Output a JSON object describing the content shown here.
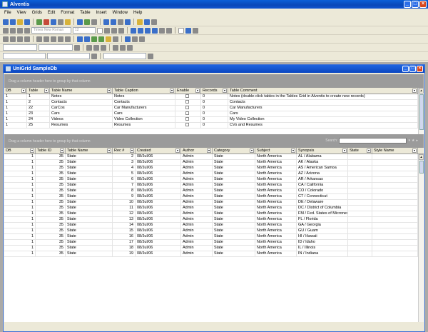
{
  "app": {
    "title": "Alventis"
  },
  "menu": [
    "File",
    "View",
    "Grids",
    "Edit",
    "Format",
    "Table",
    "Insert",
    "Window",
    "Help"
  ],
  "toolbar": {
    "font_placeholder": "Times New Roman",
    "size_placeholder": "12"
  },
  "child": {
    "title": "UniGrid SampleDb"
  },
  "tables_grid": {
    "group_prompt": "Drag a column header here to group by that column",
    "columns": [
      "DB",
      "Table",
      "Table Name",
      "Table Caption",
      "Enable",
      "Records",
      "Table Comment"
    ],
    "rows": [
      [
        "1",
        "1",
        "Notes",
        "Notes",
        "",
        "0",
        "Notes (double-click tables in the Tables Grid in Alventis to create new records)"
      ],
      [
        "1",
        "2",
        "Contacts",
        "Contacts",
        "",
        "0",
        "Contacts"
      ],
      [
        "1",
        "22",
        "CarCos",
        "Car Manufacturers",
        "",
        "0",
        "Car Manufacturers"
      ],
      [
        "1",
        "23",
        "Cars",
        "Cars",
        "",
        "0",
        "Cars"
      ],
      [
        "1",
        "24",
        "Videos",
        "Video Collection",
        "",
        "0",
        "My Video Collection"
      ],
      [
        "1",
        "25",
        "Resumes",
        "Resumes",
        "",
        "0",
        "CVs and Resumes"
      ]
    ]
  },
  "records_grid": {
    "group_prompt": "Drag a column header here to group by that column",
    "search_label": "Search:",
    "columns": [
      "DB",
      "Table ID",
      "Table Name",
      "Rec #",
      "Created",
      "Author",
      "Category",
      "Subject",
      "Synopsis",
      "State",
      "Style Name"
    ],
    "rows": [
      [
        "1",
        "35",
        "State",
        "2",
        "08/Jul/06",
        "Admin",
        "State",
        "North America",
        "AL / Alabama",
        "",
        ""
      ],
      [
        "1",
        "35",
        "State",
        "3",
        "08/Jul/06",
        "Admin",
        "State",
        "North America",
        "AK / Alaska",
        "",
        ""
      ],
      [
        "1",
        "35",
        "State",
        "4",
        "08/Jul/06",
        "Admin",
        "State",
        "North America",
        "AS / American Samoa",
        "",
        ""
      ],
      [
        "1",
        "35",
        "State",
        "5",
        "08/Jul/06",
        "Admin",
        "State",
        "North America",
        "AZ / Arizona",
        "",
        ""
      ],
      [
        "1",
        "35",
        "State",
        "6",
        "08/Jul/06",
        "Admin",
        "State",
        "North America",
        "AR / Arkansas",
        "",
        ""
      ],
      [
        "1",
        "35",
        "State",
        "7",
        "08/Jul/06",
        "Admin",
        "State",
        "North America",
        "CA / California",
        "",
        ""
      ],
      [
        "1",
        "35",
        "State",
        "8",
        "08/Jul/06",
        "Admin",
        "State",
        "North America",
        "CO / Colorado",
        "",
        ""
      ],
      [
        "1",
        "35",
        "State",
        "9",
        "08/Jul/06",
        "Admin",
        "State",
        "North America",
        "CT / Connecticut",
        "",
        ""
      ],
      [
        "1",
        "35",
        "State",
        "10",
        "08/Jul/06",
        "Admin",
        "State",
        "North America",
        "DE / Delaware",
        "",
        ""
      ],
      [
        "1",
        "35",
        "State",
        "11",
        "08/Jul/06",
        "Admin",
        "State",
        "North America",
        "DC / District of Columbia",
        "",
        ""
      ],
      [
        "1",
        "35",
        "State",
        "12",
        "08/Jul/06",
        "Admin",
        "State",
        "North America",
        "FM / Fed. States of Micronesi",
        "",
        ""
      ],
      [
        "1",
        "35",
        "State",
        "13",
        "08/Jul/06",
        "Admin",
        "State",
        "North America",
        "FL / Florida",
        "",
        ""
      ],
      [
        "1",
        "35",
        "State",
        "14",
        "08/Jul/06",
        "Admin",
        "State",
        "North America",
        "GA / Georgia",
        "",
        ""
      ],
      [
        "1",
        "35",
        "State",
        "15",
        "08/Jul/06",
        "Admin",
        "State",
        "North America",
        "GU / Guam",
        "",
        ""
      ],
      [
        "1",
        "35",
        "State",
        "16",
        "08/Jul/06",
        "Admin",
        "State",
        "North America",
        "HI / Hawaii",
        "",
        ""
      ],
      [
        "1",
        "35",
        "State",
        "17",
        "08/Jul/06",
        "Admin",
        "State",
        "North America",
        "ID / Idaho",
        "",
        ""
      ],
      [
        "1",
        "35",
        "State",
        "18",
        "08/Jul/06",
        "Admin",
        "State",
        "North America",
        "IL / Illinois",
        "",
        ""
      ],
      [
        "1",
        "35",
        "State",
        "19",
        "08/Jul/06",
        "Admin",
        "State",
        "North America",
        "IN / Indiana",
        "",
        ""
      ]
    ]
  }
}
